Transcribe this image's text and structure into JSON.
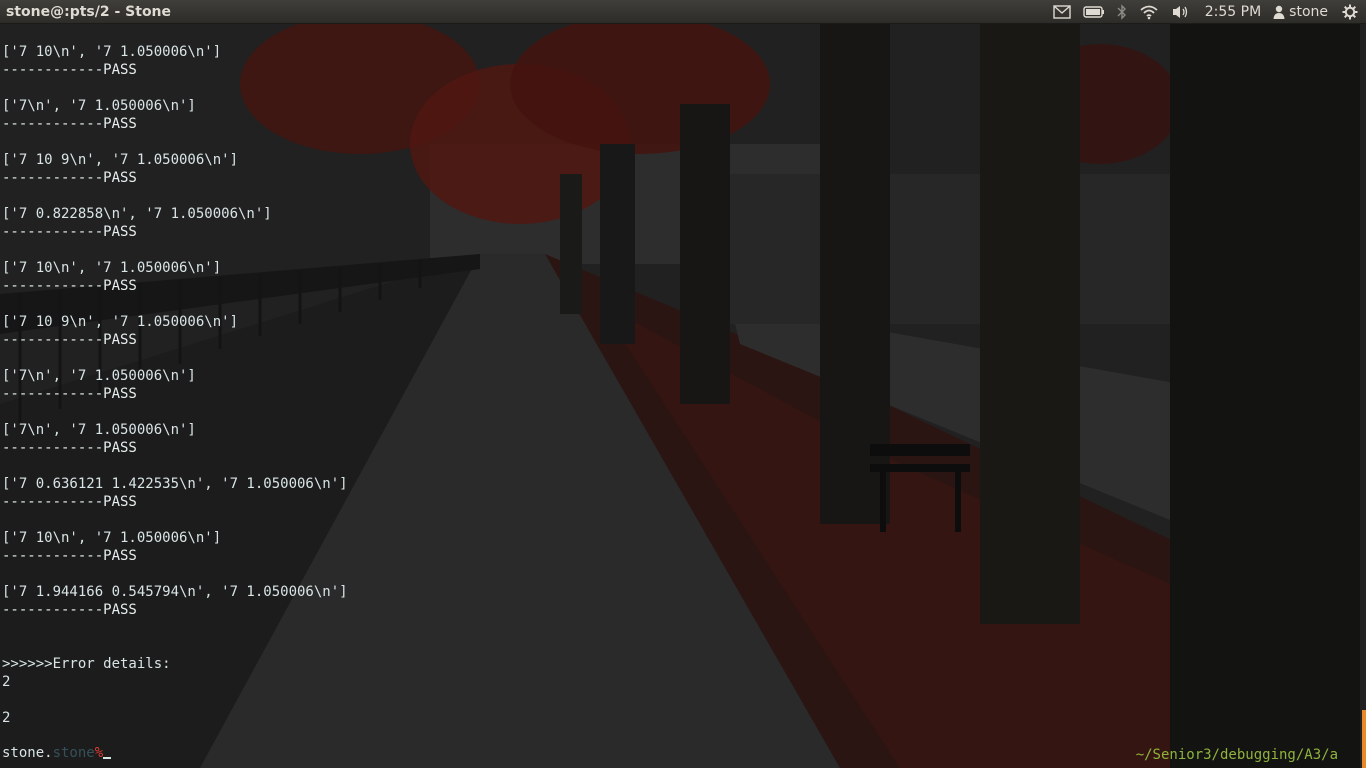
{
  "panel": {
    "window_title": "stone@:pts/2 - Stone",
    "clock": "2:55 PM",
    "username": "stone",
    "indicators": [
      "mail-icon",
      "battery-icon",
      "bluetooth-icon",
      "wifi-icon",
      "volume-icon",
      "user-icon",
      "gear-icon"
    ]
  },
  "terminal": {
    "lines": [
      "['7 10\\n', '7 1.050006\\n']",
      "------------PASS",
      "",
      "['7\\n', '7 1.050006\\n']",
      "------------PASS",
      "",
      "['7 10 9\\n', '7 1.050006\\n']",
      "------------PASS",
      "",
      "['7 0.822858\\n', '7 1.050006\\n']",
      "------------PASS",
      "",
      "['7 10\\n', '7 1.050006\\n']",
      "------------PASS",
      "",
      "['7 10 9\\n', '7 1.050006\\n']",
      "------------PASS",
      "",
      "['7\\n', '7 1.050006\\n']",
      "------------PASS",
      "",
      "['7\\n', '7 1.050006\\n']",
      "------------PASS",
      "",
      "['7 0.636121 1.422535\\n', '7 1.050006\\n']",
      "------------PASS",
      "",
      "['7 10\\n', '7 1.050006\\n']",
      "------------PASS",
      "",
      "['7 1.944166 0.545794\\n', '7 1.050006\\n']",
      "------------PASS",
      "",
      "",
      ">>>>>>Error details:",
      "2",
      "",
      "2"
    ],
    "prompt": {
      "host": "stone.",
      "user": "stone",
      "symbol": "%"
    },
    "cwd": "~/Senior3/debugging/A3/a"
  },
  "colors": {
    "text": "#d8e4e6",
    "prompt_symbol": "#e33b2f",
    "prompt_user": "#35505a",
    "cwd": "#8fb33c",
    "scroll_mark": "#e6892b"
  }
}
